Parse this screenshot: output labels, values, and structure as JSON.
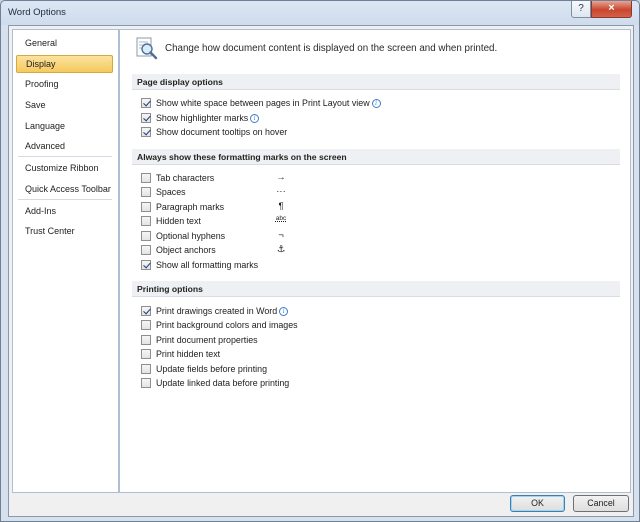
{
  "window": {
    "title": "Word Options",
    "help_glyph": "?",
    "close_glyph": "×"
  },
  "sidebar": {
    "items": [
      {
        "label": "General"
      },
      {
        "label": "Display",
        "selected": true
      },
      {
        "label": "Proofing"
      },
      {
        "label": "Save"
      },
      {
        "label": "Language"
      },
      {
        "label": "Advanced"
      },
      {
        "label": "Customize Ribbon"
      },
      {
        "label": "Quick Access Toolbar"
      },
      {
        "label": "Add-Ins"
      },
      {
        "label": "Trust Center"
      }
    ]
  },
  "header": {
    "text": "Change how document content is displayed on the screen and when printed.",
    "icon": "magnifier-document-icon"
  },
  "sections": {
    "page_display": {
      "title": "Page display options",
      "options": [
        {
          "label": "Show white space between pages in Print Layout view",
          "checked": true,
          "info": true
        },
        {
          "label": "Show highlighter marks",
          "checked": true,
          "info": true
        },
        {
          "label": "Show document tooltips on hover",
          "checked": true
        }
      ]
    },
    "formatting_marks": {
      "title": "Always show these formatting marks on the screen",
      "options": [
        {
          "label": "Tab characters",
          "checked": false,
          "symbol": "→"
        },
        {
          "label": "Spaces",
          "checked": false,
          "symbol": "···"
        },
        {
          "label": "Paragraph marks",
          "checked": false,
          "symbol": "¶"
        },
        {
          "label": "Hidden text",
          "checked": false,
          "symbol": "abc"
        },
        {
          "label": "Optional hyphens",
          "checked": false,
          "symbol": "¬"
        },
        {
          "label": "Object anchors",
          "checked": false,
          "symbol": "⚓"
        },
        {
          "label": "Show all formatting marks",
          "checked": true
        }
      ]
    },
    "printing": {
      "title": "Printing options",
      "options": [
        {
          "label": "Print drawings created in Word",
          "checked": true,
          "info": true
        },
        {
          "label": "Print background colors and images",
          "checked": false
        },
        {
          "label": "Print document properties",
          "checked": false
        },
        {
          "label": "Print hidden text",
          "checked": false
        },
        {
          "label": "Update fields before printing",
          "checked": false
        },
        {
          "label": "Update linked data before printing",
          "checked": false
        }
      ]
    }
  },
  "buttons": {
    "ok": "OK",
    "cancel": "Cancel"
  },
  "colors": {
    "selected_nav": "#f6c95e",
    "section_header": "#eef0f3",
    "accent": "#3c7fb1"
  }
}
